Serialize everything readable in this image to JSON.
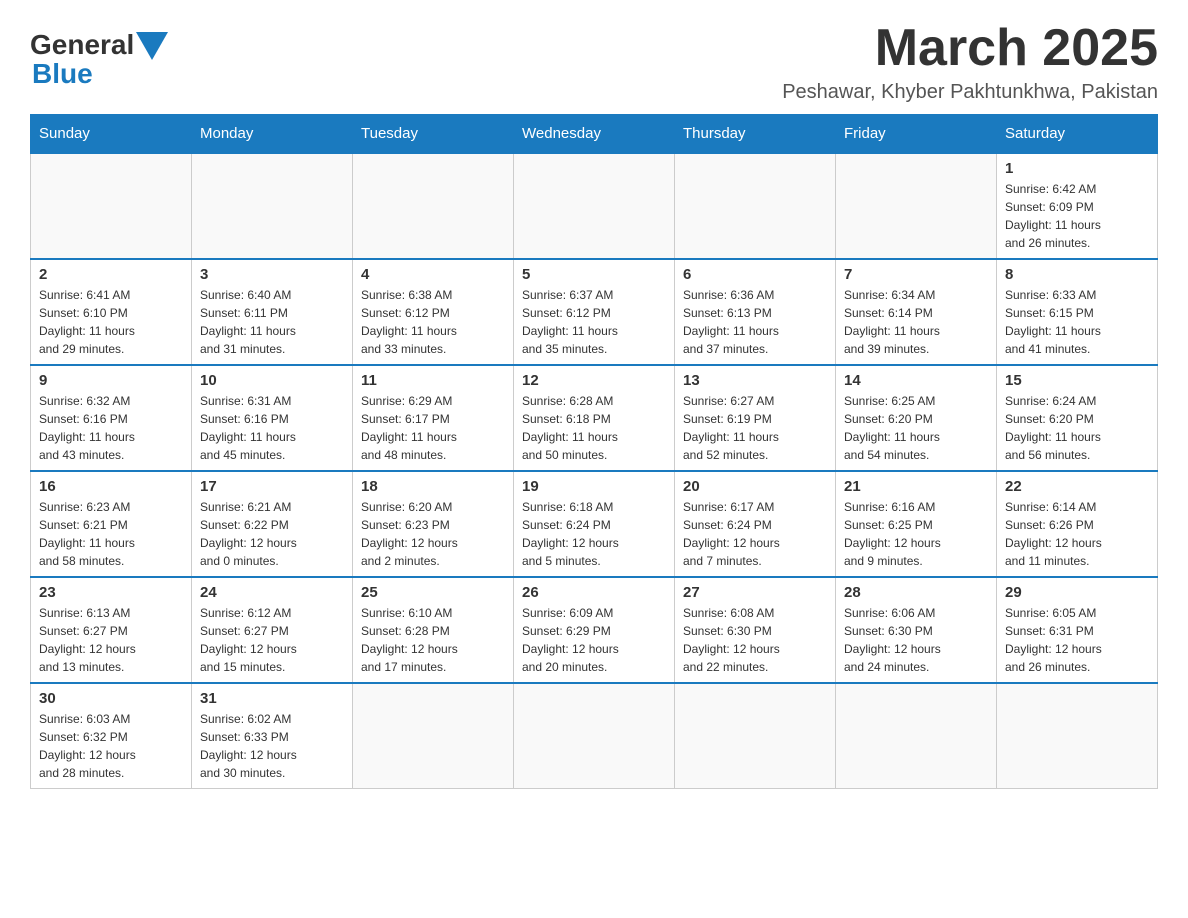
{
  "header": {
    "logo_general": "General",
    "logo_blue": "Blue",
    "month_year": "March 2025",
    "location": "Peshawar, Khyber Pakhtunkhwa, Pakistan"
  },
  "weekdays": [
    "Sunday",
    "Monday",
    "Tuesday",
    "Wednesday",
    "Thursday",
    "Friday",
    "Saturday"
  ],
  "weeks": [
    [
      {
        "day": "",
        "info": ""
      },
      {
        "day": "",
        "info": ""
      },
      {
        "day": "",
        "info": ""
      },
      {
        "day": "",
        "info": ""
      },
      {
        "day": "",
        "info": ""
      },
      {
        "day": "",
        "info": ""
      },
      {
        "day": "1",
        "info": "Sunrise: 6:42 AM\nSunset: 6:09 PM\nDaylight: 11 hours\nand 26 minutes."
      }
    ],
    [
      {
        "day": "2",
        "info": "Sunrise: 6:41 AM\nSunset: 6:10 PM\nDaylight: 11 hours\nand 29 minutes."
      },
      {
        "day": "3",
        "info": "Sunrise: 6:40 AM\nSunset: 6:11 PM\nDaylight: 11 hours\nand 31 minutes."
      },
      {
        "day": "4",
        "info": "Sunrise: 6:38 AM\nSunset: 6:12 PM\nDaylight: 11 hours\nand 33 minutes."
      },
      {
        "day": "5",
        "info": "Sunrise: 6:37 AM\nSunset: 6:12 PM\nDaylight: 11 hours\nand 35 minutes."
      },
      {
        "day": "6",
        "info": "Sunrise: 6:36 AM\nSunset: 6:13 PM\nDaylight: 11 hours\nand 37 minutes."
      },
      {
        "day": "7",
        "info": "Sunrise: 6:34 AM\nSunset: 6:14 PM\nDaylight: 11 hours\nand 39 minutes."
      },
      {
        "day": "8",
        "info": "Sunrise: 6:33 AM\nSunset: 6:15 PM\nDaylight: 11 hours\nand 41 minutes."
      }
    ],
    [
      {
        "day": "9",
        "info": "Sunrise: 6:32 AM\nSunset: 6:16 PM\nDaylight: 11 hours\nand 43 minutes."
      },
      {
        "day": "10",
        "info": "Sunrise: 6:31 AM\nSunset: 6:16 PM\nDaylight: 11 hours\nand 45 minutes."
      },
      {
        "day": "11",
        "info": "Sunrise: 6:29 AM\nSunset: 6:17 PM\nDaylight: 11 hours\nand 48 minutes."
      },
      {
        "day": "12",
        "info": "Sunrise: 6:28 AM\nSunset: 6:18 PM\nDaylight: 11 hours\nand 50 minutes."
      },
      {
        "day": "13",
        "info": "Sunrise: 6:27 AM\nSunset: 6:19 PM\nDaylight: 11 hours\nand 52 minutes."
      },
      {
        "day": "14",
        "info": "Sunrise: 6:25 AM\nSunset: 6:20 PM\nDaylight: 11 hours\nand 54 minutes."
      },
      {
        "day": "15",
        "info": "Sunrise: 6:24 AM\nSunset: 6:20 PM\nDaylight: 11 hours\nand 56 minutes."
      }
    ],
    [
      {
        "day": "16",
        "info": "Sunrise: 6:23 AM\nSunset: 6:21 PM\nDaylight: 11 hours\nand 58 minutes."
      },
      {
        "day": "17",
        "info": "Sunrise: 6:21 AM\nSunset: 6:22 PM\nDaylight: 12 hours\nand 0 minutes."
      },
      {
        "day": "18",
        "info": "Sunrise: 6:20 AM\nSunset: 6:23 PM\nDaylight: 12 hours\nand 2 minutes."
      },
      {
        "day": "19",
        "info": "Sunrise: 6:18 AM\nSunset: 6:24 PM\nDaylight: 12 hours\nand 5 minutes."
      },
      {
        "day": "20",
        "info": "Sunrise: 6:17 AM\nSunset: 6:24 PM\nDaylight: 12 hours\nand 7 minutes."
      },
      {
        "day": "21",
        "info": "Sunrise: 6:16 AM\nSunset: 6:25 PM\nDaylight: 12 hours\nand 9 minutes."
      },
      {
        "day": "22",
        "info": "Sunrise: 6:14 AM\nSunset: 6:26 PM\nDaylight: 12 hours\nand 11 minutes."
      }
    ],
    [
      {
        "day": "23",
        "info": "Sunrise: 6:13 AM\nSunset: 6:27 PM\nDaylight: 12 hours\nand 13 minutes."
      },
      {
        "day": "24",
        "info": "Sunrise: 6:12 AM\nSunset: 6:27 PM\nDaylight: 12 hours\nand 15 minutes."
      },
      {
        "day": "25",
        "info": "Sunrise: 6:10 AM\nSunset: 6:28 PM\nDaylight: 12 hours\nand 17 minutes."
      },
      {
        "day": "26",
        "info": "Sunrise: 6:09 AM\nSunset: 6:29 PM\nDaylight: 12 hours\nand 20 minutes."
      },
      {
        "day": "27",
        "info": "Sunrise: 6:08 AM\nSunset: 6:30 PM\nDaylight: 12 hours\nand 22 minutes."
      },
      {
        "day": "28",
        "info": "Sunrise: 6:06 AM\nSunset: 6:30 PM\nDaylight: 12 hours\nand 24 minutes."
      },
      {
        "day": "29",
        "info": "Sunrise: 6:05 AM\nSunset: 6:31 PM\nDaylight: 12 hours\nand 26 minutes."
      }
    ],
    [
      {
        "day": "30",
        "info": "Sunrise: 6:03 AM\nSunset: 6:32 PM\nDaylight: 12 hours\nand 28 minutes."
      },
      {
        "day": "31",
        "info": "Sunrise: 6:02 AM\nSunset: 6:33 PM\nDaylight: 12 hours\nand 30 minutes."
      },
      {
        "day": "",
        "info": ""
      },
      {
        "day": "",
        "info": ""
      },
      {
        "day": "",
        "info": ""
      },
      {
        "day": "",
        "info": ""
      },
      {
        "day": "",
        "info": ""
      }
    ]
  ]
}
